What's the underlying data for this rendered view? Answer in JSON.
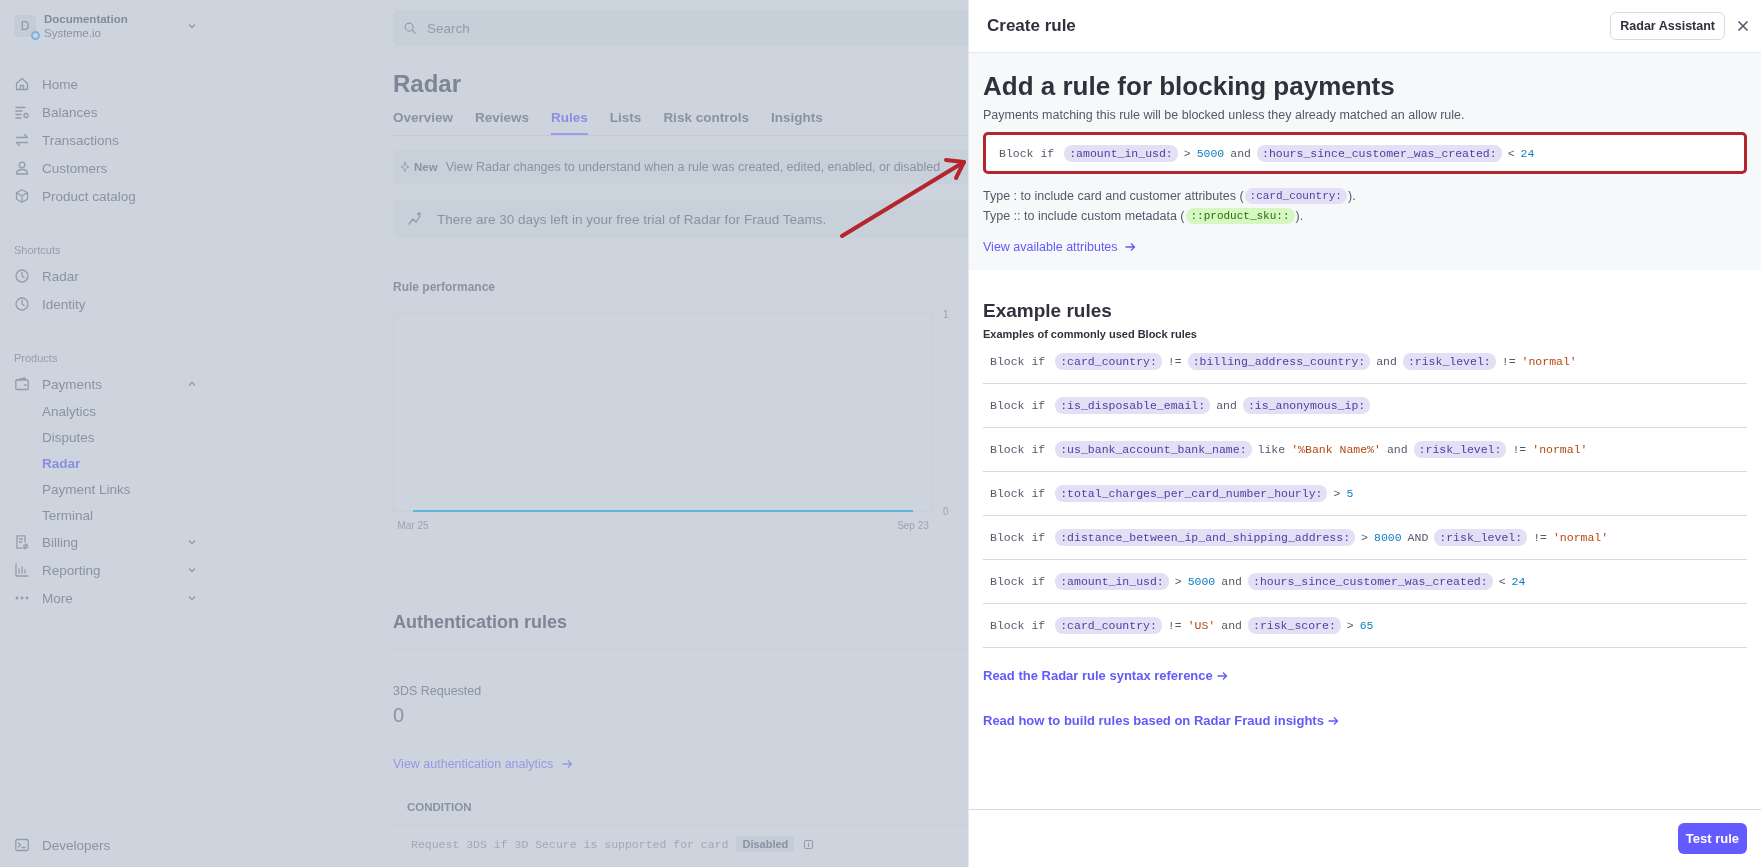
{
  "sidebar": {
    "account": {
      "initial": "D",
      "name": "Documentation",
      "subtitle": "Systeme.io"
    },
    "nav": [
      {
        "label": "Home"
      },
      {
        "label": "Balances"
      },
      {
        "label": "Transactions"
      },
      {
        "label": "Customers"
      },
      {
        "label": "Product catalog"
      }
    ],
    "shortcuts": {
      "heading": "Shortcuts",
      "items": [
        {
          "label": "Radar"
        },
        {
          "label": "Identity"
        }
      ]
    },
    "products": {
      "heading": "Products",
      "items": [
        {
          "label": "Payments",
          "expanded": true,
          "children": [
            {
              "label": "Analytics",
              "selected": false
            },
            {
              "label": "Disputes",
              "selected": false
            },
            {
              "label": "Radar",
              "selected": true
            },
            {
              "label": "Payment Links",
              "selected": false
            },
            {
              "label": "Terminal",
              "selected": false
            }
          ]
        },
        {
          "label": "Billing",
          "expanded": false
        },
        {
          "label": "Reporting",
          "expanded": false
        },
        {
          "label": "More",
          "expanded": false
        }
      ]
    },
    "footer": {
      "label": "Developers"
    }
  },
  "main": {
    "search": {
      "placeholder": "Search"
    },
    "title": "Radar",
    "tabs": [
      {
        "label": "Overview",
        "selected": false
      },
      {
        "label": "Reviews",
        "selected": false
      },
      {
        "label": "Rules",
        "selected": true
      },
      {
        "label": "Lists",
        "selected": false
      },
      {
        "label": "Risk controls",
        "selected": false
      },
      {
        "label": "Insights",
        "selected": false
      }
    ],
    "notice": {
      "badge": "New",
      "text": "View Radar changes to understand when a rule was created, edited, enabled, or disabled"
    },
    "trial": {
      "text": "There are 30 days left in your free trial of Radar for Fraud Teams."
    },
    "rule_performance": {
      "title": "Rule performance",
      "chart_data": {
        "type": "line",
        "x": [
          "Mar 25",
          "Sep 23"
        ],
        "series": [
          {
            "color": "#5bb8d8",
            "values": [
              0,
              0
            ]
          }
        ],
        "ylim": [
          0,
          1
        ],
        "yticks": [
          0,
          1
        ]
      }
    },
    "authentication": {
      "title": "Authentication rules",
      "metric_label": "3DS Requested",
      "metric_value": "0",
      "link": "View authentication analytics",
      "table": {
        "columns": [
          "CONDITION"
        ],
        "rows": [
          {
            "condition": "Request 3DS if 3D Secure is supported for card",
            "status": "Disabled"
          }
        ]
      }
    }
  },
  "panel": {
    "title": "Create rule",
    "assistant_button": "Radar Assistant",
    "heading": "Add a rule for blocking payments",
    "description": "Payments matching this rule will be blocked unless they already matched an allow rule.",
    "editor": {
      "highlighted": true,
      "tokens": [
        {
          "kind": "keyword",
          "text": "Block if"
        },
        {
          "kind": "attr",
          "text": ":amount_in_usd:"
        },
        {
          "kind": "op",
          "text": ">"
        },
        {
          "kind": "number",
          "text": "5000"
        },
        {
          "kind": "op",
          "text": "and"
        },
        {
          "kind": "attr",
          "text": ":hours_since_customer_was_created:"
        },
        {
          "kind": "op",
          "text": "<"
        },
        {
          "kind": "number",
          "text": "24"
        }
      ]
    },
    "hints": [
      {
        "before": "Type : to include card and customer attributes (",
        "token": {
          "kind": "attr",
          "text": ":card_country:"
        },
        "after": ")."
      },
      {
        "before": "Type :: to include custom metadata (",
        "token": {
          "kind": "meta",
          "text": "::product_sku::"
        },
        "after": ")."
      }
    ],
    "attributes_link": "View available attributes",
    "examples": {
      "title": "Example rules",
      "subtitle": "Examples of commonly used Block rules",
      "rules": [
        {
          "tokens": [
            {
              "kind": "keyword",
              "text": "Block if"
            },
            {
              "kind": "attr",
              "text": ":card_country:"
            },
            {
              "kind": "op",
              "text": "!="
            },
            {
              "kind": "attr",
              "text": ":billing_address_country:"
            },
            {
              "kind": "op",
              "text": "and"
            },
            {
              "kind": "attr",
              "text": ":risk_level:"
            },
            {
              "kind": "op",
              "text": "!="
            },
            {
              "kind": "string",
              "text": "'normal'"
            }
          ]
        },
        {
          "tokens": [
            {
              "kind": "keyword",
              "text": "Block if"
            },
            {
              "kind": "attr",
              "text": ":is_disposable_email:"
            },
            {
              "kind": "op",
              "text": "and"
            },
            {
              "kind": "attr",
              "text": ":is_anonymous_ip:"
            }
          ]
        },
        {
          "tokens": [
            {
              "kind": "keyword",
              "text": "Block if"
            },
            {
              "kind": "attr",
              "text": ":us_bank_account_bank_name:"
            },
            {
              "kind": "op",
              "text": "like"
            },
            {
              "kind": "string",
              "text": "'%Bank Name%'"
            },
            {
              "kind": "op",
              "text": "and"
            },
            {
              "kind": "attr",
              "text": ":risk_level:"
            },
            {
              "kind": "op",
              "text": "!="
            },
            {
              "kind": "string",
              "text": "'normal'"
            }
          ]
        },
        {
          "tokens": [
            {
              "kind": "keyword",
              "text": "Block if"
            },
            {
              "kind": "attr",
              "text": ":total_charges_per_card_number_hourly:"
            },
            {
              "kind": "op",
              "text": ">"
            },
            {
              "kind": "number",
              "text": "5"
            }
          ]
        },
        {
          "tokens": [
            {
              "kind": "keyword",
              "text": "Block if"
            },
            {
              "kind": "attr",
              "text": ":distance_between_ip_and_shipping_address:"
            },
            {
              "kind": "op",
              "text": ">"
            },
            {
              "kind": "number",
              "text": "8000"
            },
            {
              "kind": "op",
              "text": "AND"
            },
            {
              "kind": "attr",
              "text": ":risk_level:"
            },
            {
              "kind": "op",
              "text": "!="
            },
            {
              "kind": "string",
              "text": "'normal'"
            }
          ]
        },
        {
          "tokens": [
            {
              "kind": "keyword",
              "text": "Block if"
            },
            {
              "kind": "attr",
              "text": ":amount_in_usd:"
            },
            {
              "kind": "op",
              "text": ">"
            },
            {
              "kind": "number",
              "text": "5000"
            },
            {
              "kind": "op",
              "text": "and"
            },
            {
              "kind": "attr",
              "text": ":hours_since_customer_was_created:"
            },
            {
              "kind": "op",
              "text": "<"
            },
            {
              "kind": "number",
              "text": "24"
            }
          ]
        },
        {
          "tokens": [
            {
              "kind": "keyword",
              "text": "Block if"
            },
            {
              "kind": "attr",
              "text": ":card_country:"
            },
            {
              "kind": "op",
              "text": "!="
            },
            {
              "kind": "string",
              "text": "'US'"
            },
            {
              "kind": "op",
              "text": "and"
            },
            {
              "kind": "attr",
              "text": ":risk_score:"
            },
            {
              "kind": "op",
              "text": ">"
            },
            {
              "kind": "number",
              "text": "65"
            }
          ]
        }
      ]
    },
    "links": [
      "Read the Radar rule syntax reference",
      "Read how to build rules based on Radar Fraud insights"
    ],
    "submit": "Test rule"
  }
}
